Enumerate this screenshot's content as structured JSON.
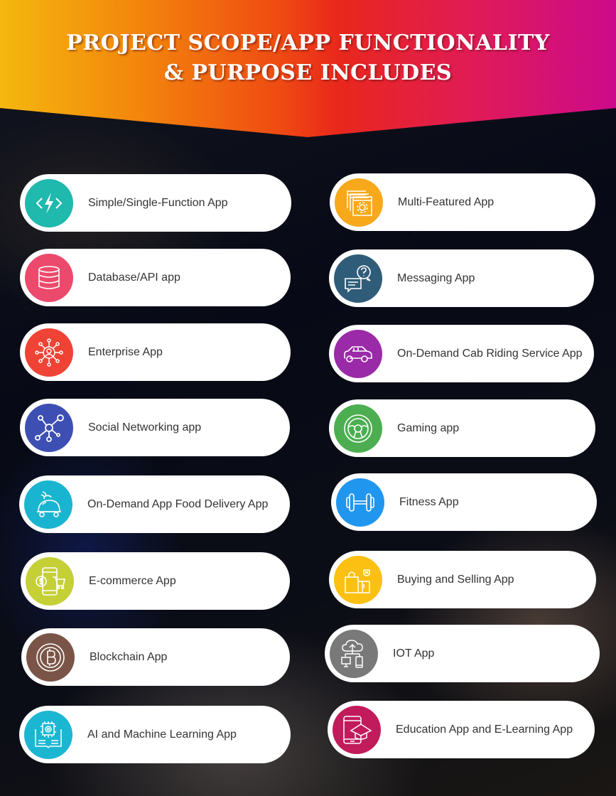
{
  "header": {
    "title_line1": "PROJECT SCOPE/APP FUNCTIONALITY",
    "title_line2": "& PURPOSE INCLUDES",
    "gradient": [
      "#f4b80e",
      "#ef4c12",
      "#cc0a8c"
    ]
  },
  "left_column": [
    {
      "label": "Simple/Single-Function App",
      "icon": "code-bolt-icon",
      "color": "#1fb9ad"
    },
    {
      "label": "Database/API app",
      "icon": "database-icon",
      "color": "#ec4a6c"
    },
    {
      "label": "Enterprise App",
      "icon": "enterprise-network-icon",
      "color": "#ef4335"
    },
    {
      "label": "Social Networking app",
      "icon": "social-network-icon",
      "color": "#3e4fb4"
    },
    {
      "label": "On-Demand App Food Delivery App",
      "icon": "food-delivery-icon",
      "color": "#19b5d0"
    },
    {
      "label": "E-commerce App",
      "icon": "ecommerce-cart-icon",
      "color": "#c5d037"
    },
    {
      "label": "Blockchain App",
      "icon": "bitcoin-icon",
      "color": "#7a5547"
    },
    {
      "label": "AI and Machine Learning App",
      "icon": "ai-chip-book-icon",
      "color": "#1bb6d2"
    }
  ],
  "right_column": [
    {
      "label": "Multi-Featured App",
      "icon": "multi-window-gear-icon",
      "color": "#f7a81b"
    },
    {
      "label": "Messaging App",
      "icon": "chat-bubbles-icon",
      "color": "#2f5d79"
    },
    {
      "label": "On-Demand Cab Riding Service App",
      "icon": "car-icon",
      "color": "#9a2aa8"
    },
    {
      "label": "Gaming app",
      "icon": "steering-wheel-icon",
      "color": "#4cae50"
    },
    {
      "label": "Fitness App",
      "icon": "dumbbell-icon",
      "color": "#2196ee"
    },
    {
      "label": "Buying and Selling App",
      "icon": "shopping-bags-icon",
      "color": "#fbc012"
    },
    {
      "label": "IOT App",
      "icon": "cloud-devices-icon",
      "color": "#797979"
    },
    {
      "label": "Education App and E-Learning App",
      "icon": "mobile-graduation-icon",
      "color": "#c21b5c"
    }
  ]
}
